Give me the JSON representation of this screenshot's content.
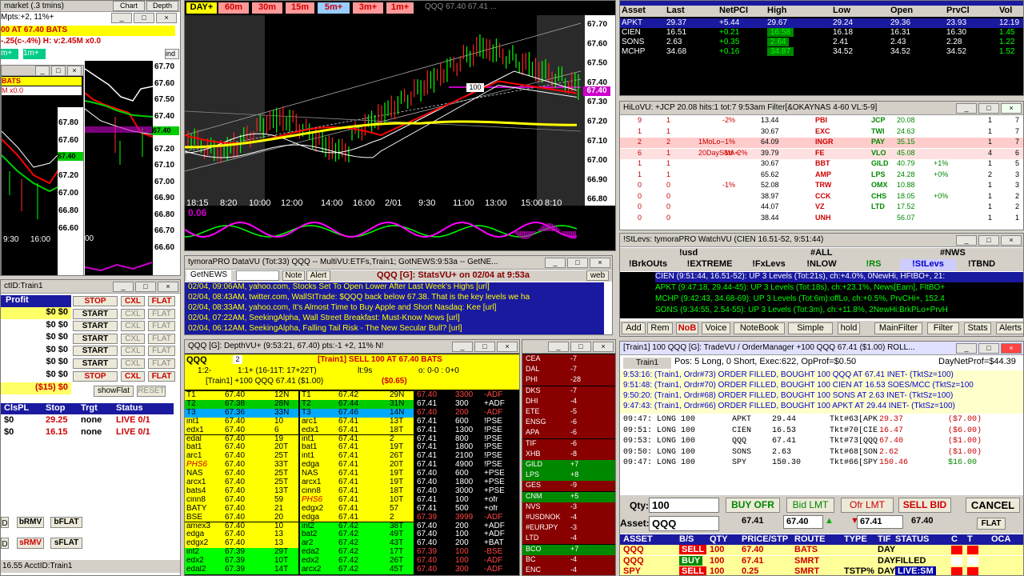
{
  "left_chart": {
    "title": "market (.3 tmins)",
    "subtitle": "Mpts:+2, 11%+",
    "buttons": [
      "Chart",
      "Depth"
    ],
    "ticker_line1": "00 AT 67.40 BATS",
    "ticker_line2": "-.25(c-.4%) H: v:2.45M x0.0",
    "tf_buttons": [
      "m+",
      "1m+"
    ],
    "ind_label": "ind",
    "inner_title": "BATS",
    "inner_ticker": "M x0.0",
    "y_ticks": [
      "67.70",
      "67.60",
      "67.50",
      "67.40",
      "67.30",
      "67.20",
      "67.10",
      "67.00",
      "66.90",
      "66.80",
      "66.70",
      "66.60"
    ],
    "inner_y_ticks": [
      "67.80",
      "67.60",
      "67.40",
      "67.20",
      "67.00",
      "66.80",
      "66.60"
    ],
    "x_ticks": [
      "9:30",
      "16:00",
      "00"
    ],
    "last_badge": "67.40"
  },
  "main_chart": {
    "tabs": [
      "DAY+",
      "60m",
      "30m",
      "15m",
      "5m+",
      "3m+",
      "1m+"
    ],
    "header_text": "QQQ 67.40 67.41 ...",
    "y_ticks": [
      "67.70",
      "67.60",
      "67.50",
      "67.40",
      "67.30",
      "67.20",
      "67.10",
      "67.00",
      "66.90",
      "66.80"
    ],
    "x_ticks": [
      "18:15",
      "8:20",
      "10:00",
      "12:00",
      "14:00",
      "16:00",
      "2/01",
      "9:30",
      "11:00",
      "13:00",
      "15:00",
      "8:10"
    ],
    "price_badge": "67.40",
    "inline_badge": "100",
    "bottom_value": "0.06",
    "top_right": "1m39"
  },
  "quotes": {
    "columns": [
      "Asset",
      "Last",
      "NetPCI",
      "High",
      "Low",
      "Open",
      "PrvCl",
      "Vol"
    ],
    "top_tabs": [
      "Asset/Vo",
      "BrkOUTs",
      "STRINGS",
      "!StLevs",
      "EM",
      "LRN",
      "LWS",
      "PAIRS",
      "Train1"
    ],
    "rows": [
      {
        "asset": "APKT",
        "last": "29.37",
        "net": "+5.44",
        "high": "29.67",
        "low": "29.24",
        "open": "29.36",
        "prv": "23.93",
        "vol": "12.19"
      },
      {
        "asset": "CIEN",
        "last": "16.51",
        "net": "+0.21",
        "high": "16.58",
        "low": "16.18",
        "open": "16.31",
        "prv": "16.30",
        "vol": "1.45"
      },
      {
        "asset": "SONS",
        "last": "2.63",
        "net": "+0.35",
        "high": "2.64",
        "low": "2.41",
        "open": "2.43",
        "prv": "2.28",
        "vol": "1.22"
      },
      {
        "asset": "MCHP",
        "last": "34.68",
        "net": "+0.16",
        "high": "34.87",
        "low": "34.52",
        "open": "34.52",
        "prv": "34.52",
        "vol": "1.52"
      }
    ]
  },
  "hilovu": {
    "title": "HiLoVU: +JCP 20.08  hits:1 tot:7 9:53am Filter[&OKAYNAS 4-60 VL:5-9]",
    "rows": [
      {
        "a": "9",
        "b": "1",
        "c": "",
        "d": "-2%",
        "e": "13.44",
        "f": "PBI",
        "g": "JCP",
        "h": "20.08",
        "i": "",
        "j": "1",
        "k": "7"
      },
      {
        "a": "1",
        "b": "1",
        "c": "",
        "d": "",
        "e": "30.67",
        "f": "EXC",
        "g": "TWI",
        "h": "24.63",
        "i": "",
        "j": "1",
        "k": "7"
      },
      {
        "a": "2",
        "b": "2",
        "c": "1MoLo-",
        "d": "-1%",
        "e": "64.09",
        "f": "INGR",
        "g": "PAY",
        "h": "35.15",
        "i": "",
        "j": "1",
        "k": "7"
      },
      {
        "a": "6",
        "b": "1",
        "c": "20DaySMA+",
        "d": "-1d -2%",
        "e": "39.79",
        "f": "FE",
        "g": "VLO",
        "h": "45.08",
        "i": "",
        "j": "4",
        "k": "6"
      },
      {
        "a": "1",
        "b": "1",
        "c": "",
        "d": "",
        "e": "30.67",
        "f": "BBT",
        "g": "GILD",
        "h": "40.79",
        "i": "+1%",
        "j": "1",
        "k": "5"
      },
      {
        "a": "1",
        "b": "1",
        "c": "",
        "d": "",
        "e": "65.62",
        "f": "AMP",
        "g": "LPS",
        "h": "24.28",
        "i": "+0%",
        "j": "2",
        "k": "3"
      },
      {
        "a": "0",
        "b": "0",
        "c": "",
        "d": "-1%",
        "e": "52.08",
        "f": "TRW",
        "g": "OMX",
        "h": "10.88",
        "i": "",
        "j": "1",
        "k": "3"
      },
      {
        "a": "0",
        "b": "0",
        "c": "",
        "d": "",
        "e": "38.97",
        "f": "CCK",
        "g": "CHS",
        "h": "18.05",
        "i": "+0%",
        "j": "1",
        "k": "2"
      },
      {
        "a": "0",
        "b": "0",
        "c": "",
        "d": "",
        "e": "44.07",
        "f": "VZ",
        "g": "LTD",
        "h": "17.52",
        "i": "",
        "j": "1",
        "k": "2"
      },
      {
        "a": "0",
        "b": "0",
        "c": "",
        "d": "",
        "e": "38.44",
        "f": "UNH",
        "g": "",
        "h": "56.07",
        "i": "",
        "j": "1",
        "k": "1"
      }
    ]
  },
  "stlevs": {
    "title": "!StLevs: tymoraPRO WatchVU  (CIEN 16.51-52, 9:51:44)",
    "group_row1": [
      "!usd",
      "#ALL",
      "#NWS"
    ],
    "group_row2": [
      "!BrkOUts",
      "!EXTREME",
      "!FxLevs",
      "!NLOW",
      "!RS",
      "!StLevs",
      "!TBND"
    ],
    "lines": [
      "CIEN (9:51:44, 16.51-52): UP 3 Levels (Tot:21s), ch:+4.0%, 0NewHi, HFtBO+, 21:",
      "APKT (9:47:18, 29.44-45): UP 3 Levels (Tot:18s), ch:+23.1%, News[Earn], FltBO+",
      "MCHP (9:42:43, 34.68-69): UP 3 Levels (Tot:6m):offLo, ch:+0.5%, PrvCHi+, 152.4",
      "SONS (9:34:55, 2.54-55): UP 3 Levels (Tot:3m), ch:+11.8%, 2NewHi:BrkPLo+PrvH"
    ],
    "toolbar": [
      "Add",
      "Rem",
      "NoB",
      "Voice",
      "NoteBook",
      "Simple",
      "hold",
      "MainFilter",
      "Filter",
      "Stats",
      "Alerts"
    ]
  },
  "datavu": {
    "title": "tymoraPRO DataVU (Tot:33) QQQ -- MultiVU:ETFs,Train1; GotNEWS:9:53a -- GetNE...",
    "tab": "GetNEWS",
    "note_btn": "Note",
    "alert_btn": "Alert",
    "center": "QQQ [G]: StatsVU+ on 02/04 at 9:53a",
    "web_btn": "web",
    "news": [
      "02/04, 09:06AM, yahoo.com, Stocks Set To Open Lower After Last Week's Highs [url]",
      "02/04, 08:43AM, twitter.com, WallStTrade: $QQQ back below 67.38. That is the key levels we ha",
      "02/04, 08:33AM, yahoo.com, It's Almost Time to Buy Apple and Short Nasdaq: Kee [url]",
      "02/04, 07:22AM, SeekingAlpha, Wall Street Breakfast: Must-Know News [url]",
      "02/04, 06:12AM, SeekingAlpha, Falling Tail Risk - The New Secular Bull? [url]"
    ]
  },
  "depth": {
    "title": "QQQ [G]: DepthVU+ (9:53:21, 67.40) pts:-1 +2, 11% N!",
    "symbol": "QQQ",
    "qty_badge": "2",
    "train_line": "[Train1]  SELL 100 AT 67.40 BATS",
    "line2_a": "1:2-",
    "line2_b": "1:1+ (16-11T: 17+22T)",
    "line2_c": "lt:9s",
    "line2_d": "o: 0-0 : 0+0",
    "line3": "[Train1] +100  QQQ 67.41 ($1.00)",
    "pl": "($0.65)",
    "bids": [
      [
        "T1",
        "67.40",
        "12N"
      ],
      [
        "T2",
        "67.38",
        "28N"
      ],
      [
        "T3",
        "67.36",
        "33N"
      ],
      [
        "int1",
        "67.40",
        "10"
      ],
      [
        "edx1",
        "67.40",
        "6"
      ],
      [
        "edal",
        "67.40",
        "19"
      ],
      [
        "bat1",
        "67.40",
        "20T"
      ],
      [
        "arc1",
        "67.40",
        "25T"
      ],
      [
        "PHS6",
        "67.40",
        "33T"
      ],
      [
        "NAS",
        "67.40",
        "25T"
      ],
      [
        "arcx1",
        "67.40",
        "25T"
      ],
      [
        "bats4",
        "67.40",
        "13T"
      ],
      [
        "cinn8",
        "67.40",
        "59"
      ],
      [
        "BATY",
        "67.40",
        "21"
      ],
      [
        "BSE",
        "67.40",
        "20"
      ],
      [
        "amex3",
        "67.40",
        "10"
      ],
      [
        "edga",
        "67.40",
        "13"
      ],
      [
        "edgx2",
        "67.40",
        "13"
      ],
      [
        "int2",
        "67.39",
        "29T"
      ],
      [
        "edx2",
        "67.39",
        "10T"
      ],
      [
        "edal2",
        "67.39",
        "14T"
      ]
    ],
    "asks": [
      [
        "T1",
        "67.42",
        "29N"
      ],
      [
        "T2",
        "67.44",
        "31N"
      ],
      [
        "T3",
        "67.46",
        "14N"
      ],
      [
        "arc1",
        "67.41",
        "13T"
      ],
      [
        "edx1",
        "67.41",
        "18T"
      ],
      [
        "int1",
        "67.41",
        "2"
      ],
      [
        "bat1",
        "67.41",
        "19T"
      ],
      [
        "int1",
        "67.41",
        "26T"
      ],
      [
        "edga",
        "67.41",
        "20T"
      ],
      [
        "NAS",
        "67.41",
        "19T"
      ],
      [
        "arcx1",
        "67.41",
        "19T"
      ],
      [
        "cinn8",
        "67.41",
        "18T"
      ],
      [
        "PHS6",
        "67.41",
        "10T"
      ],
      [
        "edgx2",
        "67.41",
        "57"
      ],
      [
        "edga",
        "67.41",
        "2"
      ],
      [
        "int2",
        "67.42",
        "38T"
      ],
      [
        "bat2",
        "67.42",
        "49T"
      ],
      [
        "ar2",
        "67.42",
        "43T"
      ],
      [
        "eda2",
        "67.42",
        "17T"
      ],
      [
        "edx2",
        "67.42",
        "26T"
      ],
      [
        "arcx2",
        "67.42",
        "45T"
      ]
    ],
    "tape": [
      [
        "67.40",
        "3300",
        "-ADF"
      ],
      [
        "67.41",
        "300",
        "+ADF"
      ],
      [
        "67.40",
        "200",
        "-ADF"
      ],
      [
        "67.41",
        "600",
        "!PSE"
      ],
      [
        "67.41",
        "1300",
        "!PSE"
      ],
      [
        "67.41",
        "800",
        "!PSE"
      ],
      [
        "67.41",
        "1800",
        "!PSE"
      ],
      [
        "67.41",
        "2100",
        "!PSE"
      ],
      [
        "67.41",
        "4900",
        "!PSE"
      ],
      [
        "67.40",
        "600",
        "+PSE"
      ],
      [
        "67.40",
        "1800",
        "+PSE"
      ],
      [
        "67.40",
        "3000",
        "+PSE"
      ],
      [
        "67.41",
        "100",
        "+ofr"
      ],
      [
        "67.41",
        "500",
        "+ofr"
      ],
      [
        "67.39",
        "3999",
        "-ADF"
      ],
      [
        "67.40",
        "200",
        "+ADF"
      ],
      [
        "67.40",
        "100",
        "+ADF"
      ],
      [
        "67.40",
        "200",
        "+BAT"
      ],
      [
        "67.39",
        "100",
        "-BSE"
      ],
      [
        "67.40",
        "100",
        "-ADF"
      ],
      [
        "67.40",
        "300",
        "-ADF"
      ]
    ]
  },
  "sectors": {
    "items": [
      [
        "CEA",
        "-7"
      ],
      [
        "DAL",
        "-7"
      ],
      [
        "PHI",
        "-28"
      ],
      [
        "DKS",
        "-7"
      ],
      [
        "DHI",
        "-4"
      ],
      [
        "ETE",
        "-5"
      ],
      [
        "ENSG",
        "-6"
      ],
      [
        "APA",
        "-6"
      ],
      [
        "TIF",
        "-6"
      ],
      [
        "XHB",
        "-8"
      ],
      [
        "GILD",
        "+7"
      ],
      [
        "LPS",
        "+8"
      ],
      [
        "GES",
        "-9"
      ],
      [
        "CNM",
        "+5"
      ],
      [
        "NVS",
        "-3"
      ],
      [
        "#USDNOK",
        "-4"
      ],
      [
        "#EURJPY",
        "-3"
      ],
      [
        "LTD",
        "-4"
      ],
      [
        "BCO",
        "+7"
      ],
      [
        "BC",
        "-4"
      ],
      [
        "ENC",
        "-4"
      ]
    ]
  },
  "left_orders": {
    "title": "ctID:Train1",
    "header": "Profit",
    "rows": [
      {
        "p": "$0 $0",
        "btn": "STOP"
      },
      {
        "p": "$0 $0",
        "btn": "START"
      },
      {
        "p": "$0 $0",
        "btn": "START"
      },
      {
        "p": "$0 $0",
        "btn": "START"
      },
      {
        "p": "$0 $0",
        "btn": "START"
      },
      {
        "p": "$0 $0",
        "btn": "START"
      },
      {
        "p": "($15) $0",
        "btn": "STOP"
      }
    ],
    "cxl": "CXL",
    "flat": "FLAT",
    "show_flat": "showFlat",
    "reset": "RESET",
    "pos_cols": [
      "ClsPL",
      "Stop",
      "Trgt",
      "Status"
    ],
    "pos_rows": [
      {
        "pl": "$0",
        "stop": "29.25",
        "trgt": "none",
        "status": "LIVE 0/1"
      },
      {
        "pl": "$0",
        "stop": "16.15",
        "trgt": "none",
        "status": "LIVE 0/1"
      }
    ],
    "bottom_btns": [
      "bRMV",
      "bFLAT",
      "sRMV",
      "sFLAT"
    ],
    "bottom_left": [
      "D",
      "D"
    ],
    "status_bar": "16.55 AcctID:Train1"
  },
  "tradevu": {
    "title": "[Train1] 100 QQQ [G]: TradeVU / OrderManager +100 QQQ 67.41 ($1.00)  ROLL...",
    "tab": "Train1",
    "pos_line": "Pos: 5 Long, 0 Short, Exec:622, OpProf=$0.50",
    "net_line": "DayNetProf=$44.39",
    "log": [
      "9:53:16: (Train1, Ordr#73) ORDER FILLED, BOUGHT 100 QQQ AT 67.41 INET- (TktSz=100)",
      "9:51:48: (Train1, Ordr#70) ORDER FILLED, BOUGHT 100 CIEN AT 16.53 SOES/MCC (TktSz=100",
      "9:50:20: (Train1, Ordr#68) ORDER FILLED, BOUGHT 100 SONS AT 2.63 INET- (TktSz=100)",
      "9:47:43: (Train1, Ordr#66) ORDER FILLED, BOUGHT 100 APKT AT 29.44 INET- (TktSz=100)"
    ],
    "positions": [
      [
        "09:47:",
        "LONG 100",
        "APKT",
        "29.44",
        "Tkt#63[APK",
        "29.37",
        "($7.00)"
      ],
      [
        "09:51:",
        "LONG 100",
        "CIEN",
        "16.53",
        "Tkt#70[CIE",
        "16.47",
        "($6.00)"
      ],
      [
        "09:53:",
        "LONG 100",
        "QQQ",
        "67.41",
        "Tkt#73[QQQ",
        "67.40",
        "($1.00)"
      ],
      [
        "09:50:",
        "LONG 100",
        "SONS",
        "2.63",
        "Tkt#68[SON",
        "2.62",
        "($1.00)"
      ],
      [
        "09:47:",
        "LONG 100",
        "SPY",
        "150.30",
        "Tkt#66[SPY",
        "150.46",
        "$16.00"
      ]
    ],
    "qty_label": "Qty:",
    "qty_value": "100",
    "buy_ofr": "BUY OFR",
    "bid_lmt": "Bid LMT",
    "ofr_lmt": "Ofr LMT",
    "sell_bid": "SELL BID",
    "cancel": "CANCEL",
    "asset_label": "Asset:",
    "asset_value": "QQQ",
    "bid_price": "67.41",
    "lmt_value": "67.40",
    "ofr_price": "67.41",
    "ask_price": "67.40",
    "flat_btn": "FLAT",
    "order_cols": [
      "ASSET",
      "B/S",
      "QTY",
      "PRICE/STP",
      "ROUTE",
      "TYPE",
      "TIF",
      "STATUS",
      "C",
      "T",
      "OCA"
    ],
    "orders": [
      {
        "asset": "QQQ",
        "bs": "SELL",
        "qty": "100",
        "price": "67.40",
        "route": "BATS",
        "type": "",
        "tif": "DAY",
        "status": ""
      },
      {
        "asset": "QQQ",
        "bs": "BUY",
        "qty": "100",
        "price": "67.41",
        "route": "SMRT",
        "type": "",
        "tif": "DAY",
        "status": "FILLED"
      },
      {
        "asset": "SPY",
        "bs": "SELL",
        "qty": "100",
        "price": "0.25",
        "route": "SMRT",
        "type": "TSTP%",
        "tif": "DAY",
        "status": "LIVE:SM"
      }
    ]
  },
  "colors": {
    "accent": "#1a1aa0",
    "yellow": "#ffff00",
    "green": "#00cc00",
    "red": "#ff0000",
    "black": "#000000"
  }
}
